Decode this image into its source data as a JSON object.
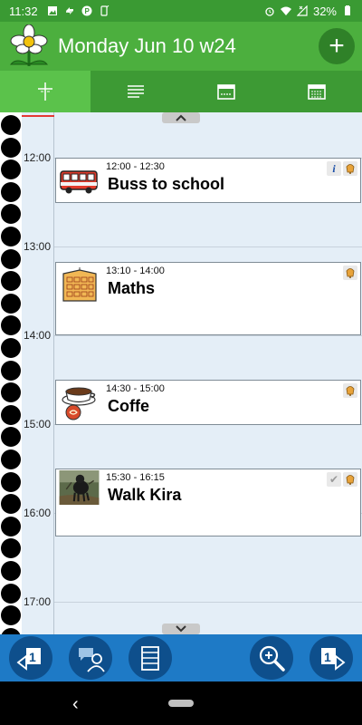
{
  "status_bar": {
    "time": "11:32",
    "battery": "32%"
  },
  "header": {
    "title": "Monday Jun 10 w24",
    "add_label": "+"
  },
  "tabs": [
    {
      "name": "day-timeline-icon",
      "active": true
    },
    {
      "name": "list-icon",
      "active": false
    },
    {
      "name": "week-calendar-icon",
      "active": false
    },
    {
      "name": "month-calendar-icon",
      "active": false
    }
  ],
  "timeline": {
    "hours": [
      "12:00",
      "13:00",
      "14:00",
      "15:00",
      "16:00",
      "17:00"
    ]
  },
  "events": [
    {
      "time": "12:00 - 12:30",
      "title": "Buss to school",
      "icon": "bus-icon",
      "flags": [
        "info-icon",
        "alarm-icon"
      ]
    },
    {
      "time": "13:10 - 14:00",
      "title": "Maths",
      "icon": "maths-board-icon",
      "flags": [
        "alarm-icon"
      ]
    },
    {
      "time": "14:30 - 15:00",
      "title": "Coffe",
      "icon": "coffee-icon",
      "flags": [
        "alarm-icon"
      ]
    },
    {
      "time": "15:30 - 16:15",
      "title": "Walk Kira",
      "icon": "dog-photo",
      "flags": [
        "check-icon",
        "alarm-icon"
      ]
    }
  ],
  "bottom_bar": {
    "buttons": [
      "previous-day-icon",
      "contacts-icon",
      "menu-icon",
      "zoom-icon",
      "next-day-icon"
    ],
    "prev_day_number": "1",
    "next_day_number": "1"
  },
  "colors": {
    "status_green": "#3a9a33",
    "header_green": "#4caf3e",
    "tab_active": "#5bc24b",
    "bottom_blue": "#1e7ac6",
    "button_blue": "#0e4f8c"
  }
}
